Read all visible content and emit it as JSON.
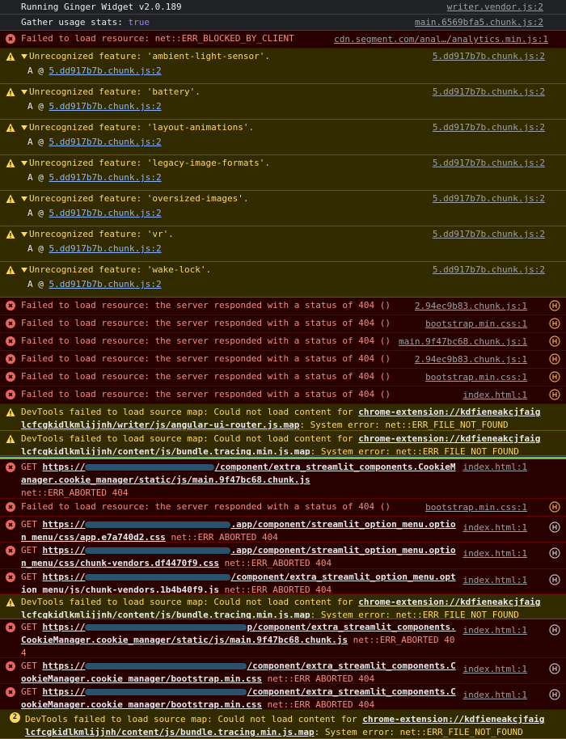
{
  "top": {
    "widget": "Running Ginger Widget v2.0.189",
    "widget_src": "writer.vendor.js:2",
    "gather_label": "Gather usage stats:",
    "gather_value": "true",
    "gather_src": "main.6569bfa5.chunk.js:2"
  },
  "blocked": {
    "text": "Failed to load resource: net::ERR_BLOCKED_BY_CLIENT",
    "src": "cdn.segment.com/anal…/analytics.min.js:1"
  },
  "features": [
    {
      "text": "Unrecognized feature: 'ambient-light-sensor'.",
      "src": "5.dd917b7b.chunk.js:2",
      "stack_prefix": "A @ ",
      "stack_link": "5.dd917b7b.chunk.js:2"
    },
    {
      "text": "Unrecognized feature: 'battery'.",
      "src": "5.dd917b7b.chunk.js:2",
      "stack_prefix": "A @ ",
      "stack_link": "5.dd917b7b.chunk.js:2"
    },
    {
      "text": "Unrecognized feature: 'layout-animations'.",
      "src": "5.dd917b7b.chunk.js:2",
      "stack_prefix": "A @ ",
      "stack_link": "5.dd917b7b.chunk.js:2"
    },
    {
      "text": "Unrecognized feature: 'legacy-image-formats'.",
      "src": "5.dd917b7b.chunk.js:2",
      "stack_prefix": "A @ ",
      "stack_link": "5.dd917b7b.chunk.js:2"
    },
    {
      "text": "Unrecognized feature: 'oversized-images'.",
      "src": "5.dd917b7b.chunk.js:2",
      "stack_prefix": "A @ ",
      "stack_link": "5.dd917b7b.chunk.js:2"
    },
    {
      "text": "Unrecognized feature: 'vr'.",
      "src": "5.dd917b7b.chunk.js:2",
      "stack_prefix": "A @ ",
      "stack_link": "5.dd917b7b.chunk.js:2"
    },
    {
      "text": "Unrecognized feature: 'wake-lock'.",
      "src": "5.dd917b7b.chunk.js:2",
      "stack_prefix": "A @ ",
      "stack_link": "5.dd917b7b.chunk.js:2"
    }
  ],
  "errors404": [
    {
      "text": "Failed to load resource: the server responded with a status of 404 ()",
      "src": "2.94ec9b83.chunk.js:1"
    },
    {
      "text": "Failed to load resource: the server responded with a status of 404 ()",
      "src": "bootstrap.min.css:1"
    },
    {
      "text": "Failed to load resource: the server responded with a status of 404 ()",
      "src": "main.9f47bc68.chunk.js:1"
    },
    {
      "text": "Failed to load resource: the server responded with a status of 404 ()",
      "src": "2.94ec9b83.chunk.js:1"
    },
    {
      "text": "Failed to load resource: the server responded with a status of 404 ()",
      "src": "bootstrap.min.css:1"
    },
    {
      "text": "Failed to load resource: the server responded with a status of 404 ()",
      "src": "index.html:1"
    }
  ],
  "devtools1": {
    "prefix": "DevTools failed to load source map: Could not load content for ",
    "url": "chrome-extension://kdfieneakcjfaiglcfcgkidlkmlijjnh/writer/js/angular-ui-router.js.map",
    "suffix": ": System error: net::ERR_FILE_NOT_FOUND"
  },
  "devtools2": {
    "prefix": "DevTools failed to load source map: Could not load content for ",
    "url": "chrome-extension://kdfieneakcjfaiglcfcgkidlkmlijjnh/content/js/bundle.tracing.min.js.map",
    "suffix": ": System error: net::ERR_FILE_NOT_FOUND"
  },
  "get1": {
    "method": "GET",
    "url_start": "https://",
    "url_end": "/component/extra_streamlit_components.CookieManager.cookie_manager/static/js/main.9f47bc68.chunk.js",
    "tail": "net::ERR_ABORTED 404",
    "src": "index.html:1"
  },
  "err404b": {
    "text": "Failed to load resource: the server responded with a status of 404 ()",
    "src": "bootstrap.min.css:1"
  },
  "get2": {
    "method": "GET",
    "url_start": "https://",
    "url_end": ".app/component/streamlit_option_menu.option_menu/css/app.e7a740d2.css",
    "tail": "net::ERR_ABORTED 404",
    "src": "index.html:1"
  },
  "get3": {
    "method": "GET",
    "url_start": "https://",
    "url_end": ".app/component/streamlit_option_menu.option_menu/css/chunk-vendors.df4470f9.css",
    "tail": "net::ERR_ABORTED 404",
    "src": "index.html:1"
  },
  "get4": {
    "method": "GET",
    "url_start": "https://",
    "url_end": "/component/extra_streamlit_option_menu.option_menu/js/chunk-vendors.1b4b40f9.js",
    "tail": "net::ERR_ABORTED 404",
    "src": "index.html:1"
  },
  "devtools3": {
    "prefix": "DevTools failed to load source map: Could not load content for ",
    "url": "chrome-extension://kdfieneakcjfaiglcfcgkidlkmlijjnh/content/js/bundle.tracing.min.js.map",
    "suffix": ": System error: net::ERR_FILE_NOT_FOUND"
  },
  "get5": {
    "method": "GET",
    "url_start": "https://",
    "url_end": "p/component/extra_streamlit_components.CookieManager.cookie_manager/static/js/main.9f47bc68.chunk.js",
    "tail": "net::ERR_ABORTED 404",
    "src": "index.html:1"
  },
  "get6": {
    "method": "GET",
    "url_start": "https://",
    "url_end": "/component/extra_streamlit_components.CookieManager.cookie_manager/bootstrap.min.css",
    "tail": "net::ERR_ABORTED 404",
    "src": "index.html:1"
  },
  "get7": {
    "method": "GET",
    "url_start": "https://",
    "url_end": "/component/extra_streamlit_components.CookieManager.cookie_manager/bootstrap.min.css",
    "tail": "net::ERR_ABORTED 404",
    "src": "index.html:1"
  },
  "devtools4": {
    "count": "2",
    "prefix": "DevTools failed to load source map: Could not load content for ",
    "url": "chrome-extension://kdfieneakcjfaiglcfcgkidlkmlijjnh/content/js/bundle.tracing.min.js.map",
    "suffix": ": System error: net::ERR_FILE_NOT_FOUND"
  },
  "colors": {
    "error_bg": "#290000",
    "warn_bg": "#332b00",
    "error_text": "#f28b82",
    "warn_text": "#fdd663",
    "separator": "#6abf4b"
  }
}
